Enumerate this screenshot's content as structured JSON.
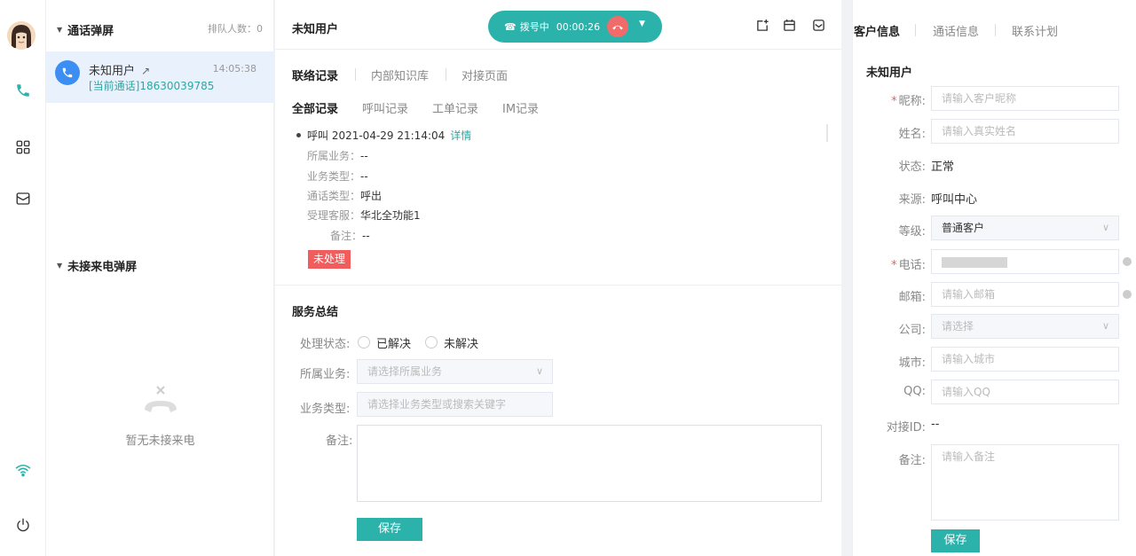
{
  "rail": {
    "icons": [
      "avatar",
      "phone-icon",
      "grid-icon",
      "mail-icon",
      "wifi-icon",
      "power-icon"
    ],
    "accent": "#2bb2aa"
  },
  "call_panel": {
    "section_title": "通话弹屏",
    "queue": "排队人数：0",
    "active_call": {
      "name": "未知用户",
      "time": "14:05:38",
      "tag": "[当前通话]",
      "number": "18630039785"
    },
    "missed_title": "未接来电弹屏",
    "empty_text": "暂无未接来电"
  },
  "middle": {
    "title": "未知用户",
    "dialing": {
      "status": "拨号中",
      "timer": "00:00:26"
    },
    "tabs": [
      "联络记录",
      "内部知识库",
      "对接页面"
    ],
    "subtabs": [
      "全部记录",
      "呼叫记录",
      "工单记录",
      "IM记录"
    ],
    "record": {
      "headline": "呼叫 2021-04-29 21:14:04",
      "link": "详情",
      "fields": [
        {
          "k": "所属业务：",
          "v": "--"
        },
        {
          "k": "业务类型：",
          "v": "--"
        },
        {
          "k": "通话类型：",
          "v": "呼出"
        },
        {
          "k": "受理客服：",
          "v": "华北全功能1"
        },
        {
          "k": "备注：",
          "v": "--"
        }
      ],
      "status_tag": "未处理"
    },
    "service": {
      "title": "服务总结",
      "status_label": "处理状态:",
      "opt_resolved": "已解决",
      "opt_unresolved": "未解决",
      "biz_label": "所属业务:",
      "biz_placeholder": "请选择所属业务",
      "type_label": "业务类型:",
      "type_placeholder": "请选择业务类型或搜索关键字",
      "remark_label": "备注:",
      "save": "保存"
    }
  },
  "right": {
    "tabs": [
      "客户信息",
      "通话信息",
      "联系计划"
    ],
    "user_title": "未知用户",
    "nick_label": "昵称:",
    "nick_placeholder": "请输入客户昵称",
    "name_label": "姓名:",
    "name_placeholder": "请输入真实姓名",
    "status_label": "状态:",
    "status_value": "正常",
    "source_label": "来源:",
    "source_value": "呼叫中心",
    "level_label": "等级:",
    "level_value": "普通客户",
    "phone_label": "电话:",
    "email_label": "邮箱:",
    "email_placeholder": "请输入邮箱",
    "company_label": "公司:",
    "company_placeholder": "请选择",
    "city_label": "城市:",
    "city_placeholder": "请输入城市",
    "qq_label": "QQ:",
    "qq_placeholder": "请输入QQ",
    "dock_label": "对接ID:",
    "dock_value": "--",
    "remark_label": "备注:",
    "remark_placeholder": "请输入备注",
    "save": "保存"
  }
}
